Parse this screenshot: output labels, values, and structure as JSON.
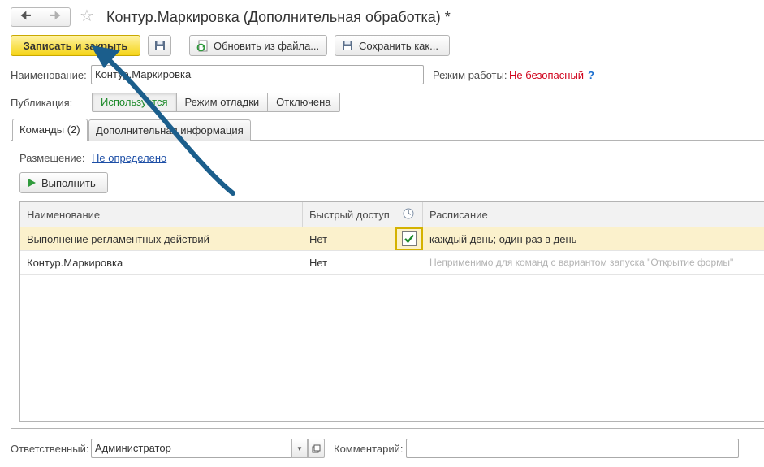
{
  "window": {
    "title": "Контур.Маркировка (Дополнительная обработка) *"
  },
  "nav": {
    "back_icon": "arrow-left-icon",
    "forward_icon": "arrow-right-icon",
    "favorite_icon": "star-icon"
  },
  "toolbar": {
    "save_close_label": "Записать и закрыть",
    "save_icon": "floppy-disk-icon",
    "update_from_file_label": "Обновить из файла...",
    "save_as_label": "Сохранить как..."
  },
  "form": {
    "name_label": "Наименование:",
    "name_value": "Контур.Маркировка",
    "mode_label": "Режим работы:",
    "mode_value": "Не безопасный",
    "mode_help": "?",
    "publication_label": "Публикация:",
    "publication_options": [
      "Используется",
      "Режим отладки",
      "Отключена"
    ],
    "publication_selected": "Используется"
  },
  "tabs": [
    {
      "label": "Команды (2)",
      "active": true
    },
    {
      "label": "Дополнительная информация",
      "active": false
    }
  ],
  "commands": {
    "placement_label": "Размещение:",
    "placement_value": "Не определено",
    "run_label": "Выполнить",
    "columns": [
      "Наименование",
      "Быстрый доступ",
      "",
      "Расписание"
    ],
    "rows": [
      {
        "name": "Выполнение регламентных действий",
        "quick": "Нет",
        "scheduled": true,
        "schedule": "каждый день; один раз в день"
      },
      {
        "name": "Контур.Маркировка",
        "quick": "Нет",
        "scheduled": false,
        "schedule": "Неприменимо для команд с вариантом запуска \"Открытие формы\""
      }
    ]
  },
  "footer": {
    "responsible_label": "Ответственный:",
    "responsible_value": "Администратор",
    "comment_label": "Комментарий:",
    "comment_value": ""
  },
  "colors": {
    "accent": "#f5d417",
    "link": "#1c4ea6",
    "danger": "#d0021b",
    "success": "#1d8a2a",
    "annotation_arrow": "#1b5e8c"
  }
}
